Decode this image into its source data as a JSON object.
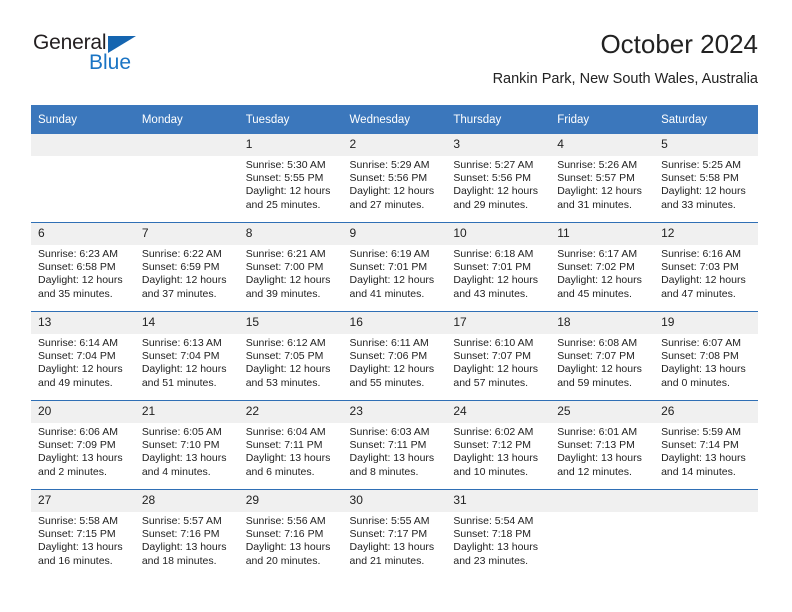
{
  "logo": {
    "word_general": "General",
    "word_blue": "Blue",
    "triangle_color": "#1565b0",
    "blue_text_color": "#1a74c4"
  },
  "header": {
    "month_title": "October 2024",
    "location": "Rankin Park, New South Wales, Australia"
  },
  "theme": {
    "header_bg": "#3b77bc",
    "header_text": "#ffffff",
    "row_divider": "#2f6fb5",
    "daynum_bg": "#f0f0f0",
    "body_text": "#222222"
  },
  "calendar": {
    "weekday_headers": [
      "Sunday",
      "Monday",
      "Tuesday",
      "Wednesday",
      "Thursday",
      "Friday",
      "Saturday"
    ],
    "weeks": [
      [
        {
          "day": "",
          "sunrise": "",
          "sunset": "",
          "daylight_line1": "",
          "daylight_line2": ""
        },
        {
          "day": "",
          "sunrise": "",
          "sunset": "",
          "daylight_line1": "",
          "daylight_line2": ""
        },
        {
          "day": "1",
          "sunrise": "Sunrise: 5:30 AM",
          "sunset": "Sunset: 5:55 PM",
          "daylight_line1": "Daylight: 12 hours",
          "daylight_line2": "and 25 minutes."
        },
        {
          "day": "2",
          "sunrise": "Sunrise: 5:29 AM",
          "sunset": "Sunset: 5:56 PM",
          "daylight_line1": "Daylight: 12 hours",
          "daylight_line2": "and 27 minutes."
        },
        {
          "day": "3",
          "sunrise": "Sunrise: 5:27 AM",
          "sunset": "Sunset: 5:56 PM",
          "daylight_line1": "Daylight: 12 hours",
          "daylight_line2": "and 29 minutes."
        },
        {
          "day": "4",
          "sunrise": "Sunrise: 5:26 AM",
          "sunset": "Sunset: 5:57 PM",
          "daylight_line1": "Daylight: 12 hours",
          "daylight_line2": "and 31 minutes."
        },
        {
          "day": "5",
          "sunrise": "Sunrise: 5:25 AM",
          "sunset": "Sunset: 5:58 PM",
          "daylight_line1": "Daylight: 12 hours",
          "daylight_line2": "and 33 minutes."
        }
      ],
      [
        {
          "day": "6",
          "sunrise": "Sunrise: 6:23 AM",
          "sunset": "Sunset: 6:58 PM",
          "daylight_line1": "Daylight: 12 hours",
          "daylight_line2": "and 35 minutes."
        },
        {
          "day": "7",
          "sunrise": "Sunrise: 6:22 AM",
          "sunset": "Sunset: 6:59 PM",
          "daylight_line1": "Daylight: 12 hours",
          "daylight_line2": "and 37 minutes."
        },
        {
          "day": "8",
          "sunrise": "Sunrise: 6:21 AM",
          "sunset": "Sunset: 7:00 PM",
          "daylight_line1": "Daylight: 12 hours",
          "daylight_line2": "and 39 minutes."
        },
        {
          "day": "9",
          "sunrise": "Sunrise: 6:19 AM",
          "sunset": "Sunset: 7:01 PM",
          "daylight_line1": "Daylight: 12 hours",
          "daylight_line2": "and 41 minutes."
        },
        {
          "day": "10",
          "sunrise": "Sunrise: 6:18 AM",
          "sunset": "Sunset: 7:01 PM",
          "daylight_line1": "Daylight: 12 hours",
          "daylight_line2": "and 43 minutes."
        },
        {
          "day": "11",
          "sunrise": "Sunrise: 6:17 AM",
          "sunset": "Sunset: 7:02 PM",
          "daylight_line1": "Daylight: 12 hours",
          "daylight_line2": "and 45 minutes."
        },
        {
          "day": "12",
          "sunrise": "Sunrise: 6:16 AM",
          "sunset": "Sunset: 7:03 PM",
          "daylight_line1": "Daylight: 12 hours",
          "daylight_line2": "and 47 minutes."
        }
      ],
      [
        {
          "day": "13",
          "sunrise": "Sunrise: 6:14 AM",
          "sunset": "Sunset: 7:04 PM",
          "daylight_line1": "Daylight: 12 hours",
          "daylight_line2": "and 49 minutes."
        },
        {
          "day": "14",
          "sunrise": "Sunrise: 6:13 AM",
          "sunset": "Sunset: 7:04 PM",
          "daylight_line1": "Daylight: 12 hours",
          "daylight_line2": "and 51 minutes."
        },
        {
          "day": "15",
          "sunrise": "Sunrise: 6:12 AM",
          "sunset": "Sunset: 7:05 PM",
          "daylight_line1": "Daylight: 12 hours",
          "daylight_line2": "and 53 minutes."
        },
        {
          "day": "16",
          "sunrise": "Sunrise: 6:11 AM",
          "sunset": "Sunset: 7:06 PM",
          "daylight_line1": "Daylight: 12 hours",
          "daylight_line2": "and 55 minutes."
        },
        {
          "day": "17",
          "sunrise": "Sunrise: 6:10 AM",
          "sunset": "Sunset: 7:07 PM",
          "daylight_line1": "Daylight: 12 hours",
          "daylight_line2": "and 57 minutes."
        },
        {
          "day": "18",
          "sunrise": "Sunrise: 6:08 AM",
          "sunset": "Sunset: 7:07 PM",
          "daylight_line1": "Daylight: 12 hours",
          "daylight_line2": "and 59 minutes."
        },
        {
          "day": "19",
          "sunrise": "Sunrise: 6:07 AM",
          "sunset": "Sunset: 7:08 PM",
          "daylight_line1": "Daylight: 13 hours",
          "daylight_line2": "and 0 minutes."
        }
      ],
      [
        {
          "day": "20",
          "sunrise": "Sunrise: 6:06 AM",
          "sunset": "Sunset: 7:09 PM",
          "daylight_line1": "Daylight: 13 hours",
          "daylight_line2": "and 2 minutes."
        },
        {
          "day": "21",
          "sunrise": "Sunrise: 6:05 AM",
          "sunset": "Sunset: 7:10 PM",
          "daylight_line1": "Daylight: 13 hours",
          "daylight_line2": "and 4 minutes."
        },
        {
          "day": "22",
          "sunrise": "Sunrise: 6:04 AM",
          "sunset": "Sunset: 7:11 PM",
          "daylight_line1": "Daylight: 13 hours",
          "daylight_line2": "and 6 minutes."
        },
        {
          "day": "23",
          "sunrise": "Sunrise: 6:03 AM",
          "sunset": "Sunset: 7:11 PM",
          "daylight_line1": "Daylight: 13 hours",
          "daylight_line2": "and 8 minutes."
        },
        {
          "day": "24",
          "sunrise": "Sunrise: 6:02 AM",
          "sunset": "Sunset: 7:12 PM",
          "daylight_line1": "Daylight: 13 hours",
          "daylight_line2": "and 10 minutes."
        },
        {
          "day": "25",
          "sunrise": "Sunrise: 6:01 AM",
          "sunset": "Sunset: 7:13 PM",
          "daylight_line1": "Daylight: 13 hours",
          "daylight_line2": "and 12 minutes."
        },
        {
          "day": "26",
          "sunrise": "Sunrise: 5:59 AM",
          "sunset": "Sunset: 7:14 PM",
          "daylight_line1": "Daylight: 13 hours",
          "daylight_line2": "and 14 minutes."
        }
      ],
      [
        {
          "day": "27",
          "sunrise": "Sunrise: 5:58 AM",
          "sunset": "Sunset: 7:15 PM",
          "daylight_line1": "Daylight: 13 hours",
          "daylight_line2": "and 16 minutes."
        },
        {
          "day": "28",
          "sunrise": "Sunrise: 5:57 AM",
          "sunset": "Sunset: 7:16 PM",
          "daylight_line1": "Daylight: 13 hours",
          "daylight_line2": "and 18 minutes."
        },
        {
          "day": "29",
          "sunrise": "Sunrise: 5:56 AM",
          "sunset": "Sunset: 7:16 PM",
          "daylight_line1": "Daylight: 13 hours",
          "daylight_line2": "and 20 minutes."
        },
        {
          "day": "30",
          "sunrise": "Sunrise: 5:55 AM",
          "sunset": "Sunset: 7:17 PM",
          "daylight_line1": "Daylight: 13 hours",
          "daylight_line2": "and 21 minutes."
        },
        {
          "day": "31",
          "sunrise": "Sunrise: 5:54 AM",
          "sunset": "Sunset: 7:18 PM",
          "daylight_line1": "Daylight: 13 hours",
          "daylight_line2": "and 23 minutes."
        },
        {
          "day": "",
          "sunrise": "",
          "sunset": "",
          "daylight_line1": "",
          "daylight_line2": ""
        },
        {
          "day": "",
          "sunrise": "",
          "sunset": "",
          "daylight_line1": "",
          "daylight_line2": ""
        }
      ]
    ]
  }
}
